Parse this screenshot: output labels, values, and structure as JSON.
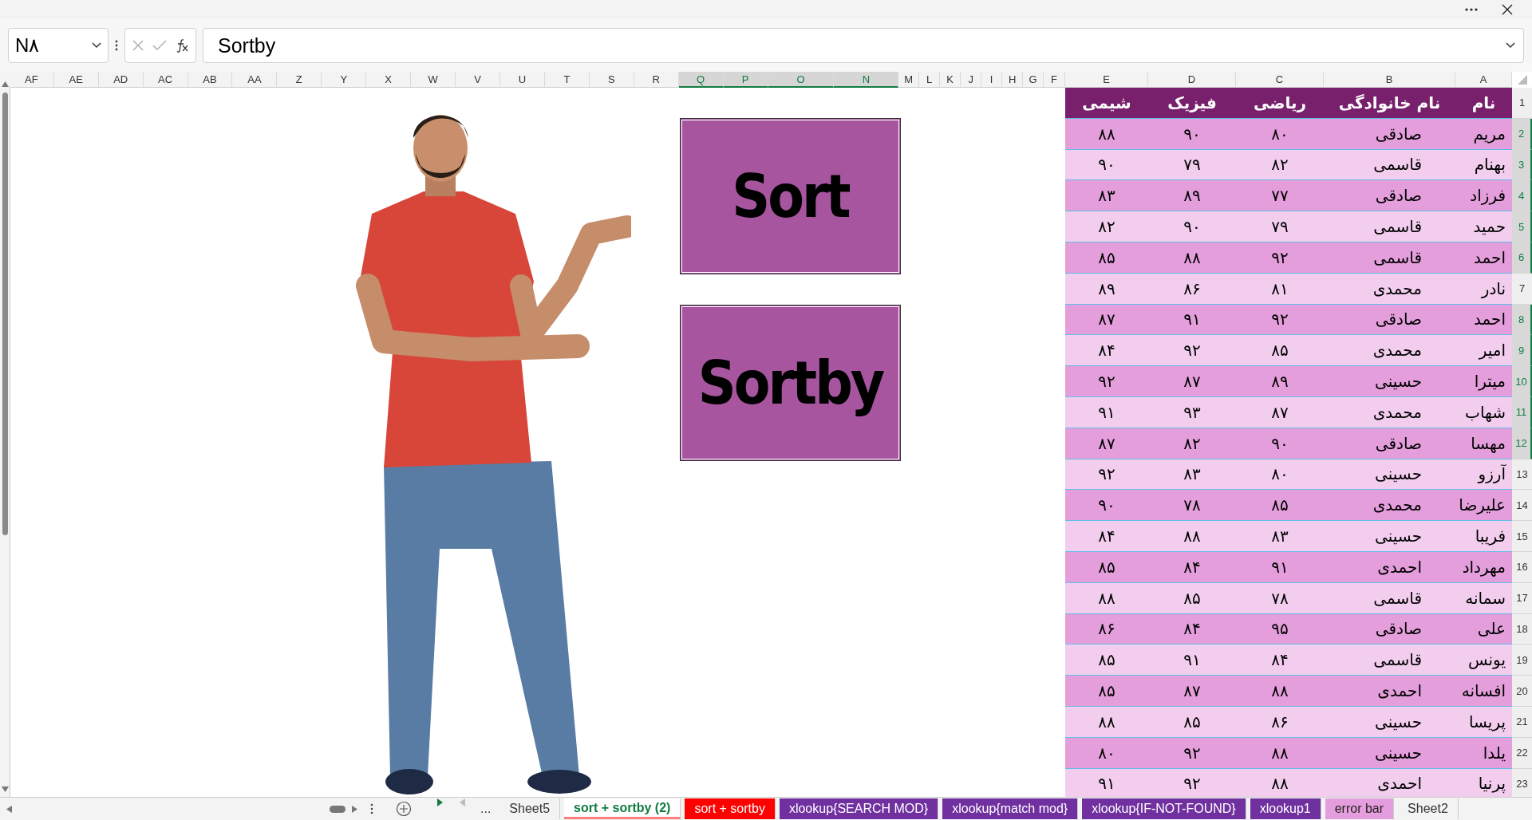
{
  "name_box": {
    "value": "N۸"
  },
  "formula_bar": {
    "value": "Sortby"
  },
  "columns_left": [
    {
      "label": "F",
      "selected": false
    },
    {
      "label": "G",
      "selected": false
    },
    {
      "label": "H",
      "selected": false
    },
    {
      "label": "I",
      "selected": false
    },
    {
      "label": "J",
      "selected": false
    },
    {
      "label": "K",
      "selected": false
    },
    {
      "label": "L",
      "selected": false
    },
    {
      "label": "M",
      "selected": false
    },
    {
      "label": "N",
      "selected": true
    },
    {
      "label": "O",
      "selected": true
    },
    {
      "label": "P",
      "selected": true
    },
    {
      "label": "Q",
      "selected": true
    },
    {
      "label": "R",
      "selected": false
    },
    {
      "label": "S",
      "selected": false
    },
    {
      "label": "T",
      "selected": false
    },
    {
      "label": "U",
      "selected": false
    },
    {
      "label": "V",
      "selected": false
    },
    {
      "label": "W",
      "selected": false
    },
    {
      "label": "X",
      "selected": false
    },
    {
      "label": "Y",
      "selected": false
    },
    {
      "label": "Z",
      "selected": false
    },
    {
      "label": "AA",
      "selected": false
    },
    {
      "label": "AB",
      "selected": false
    },
    {
      "label": "AC",
      "selected": false
    },
    {
      "label": "AD",
      "selected": false
    },
    {
      "label": "AE",
      "selected": false
    },
    {
      "label": "AF",
      "selected": false
    }
  ],
  "shapes": [
    {
      "label": "Sort"
    },
    {
      "label": "Sortby"
    }
  ],
  "table": {
    "columns": [
      {
        "letter": "A",
        "selected": false
      },
      {
        "letter": "B",
        "selected": false
      },
      {
        "letter": "C",
        "selected": false
      },
      {
        "letter": "D",
        "selected": false
      },
      {
        "letter": "E",
        "selected": false
      }
    ],
    "rows": [
      {
        "number": "1",
        "selected": false,
        "kind": "header",
        "cells": [
          "نام",
          "نام خانوادگی",
          "ریاضی",
          "فیزیک",
          "شیمی"
        ]
      },
      {
        "number": "2",
        "selected": true,
        "kind": "data",
        "cells": [
          "مریم",
          "صادقی",
          "۸۰",
          "۹۰",
          "۸۸"
        ]
      },
      {
        "number": "3",
        "selected": true,
        "kind": "data",
        "cells": [
          "بهنام",
          "قاسمی",
          "۸۲",
          "۷۹",
          "۹۰"
        ]
      },
      {
        "number": "4",
        "selected": true,
        "kind": "data",
        "cells": [
          "فرزاد",
          "صادقی",
          "۷۷",
          "۸۹",
          "۸۳"
        ]
      },
      {
        "number": "5",
        "selected": true,
        "kind": "data",
        "cells": [
          "حمید",
          "قاسمی",
          "۷۹",
          "۹۰",
          "۸۲"
        ]
      },
      {
        "number": "6",
        "selected": true,
        "kind": "data",
        "cells": [
          "احمد",
          "قاسمی",
          "۹۲",
          "۸۸",
          "۸۵"
        ]
      },
      {
        "number": "7",
        "selected": false,
        "kind": "data",
        "cells": [
          "نادر",
          "محمدی",
          "۸۱",
          "۸۶",
          "۸۹"
        ]
      },
      {
        "number": "8",
        "selected": true,
        "kind": "data",
        "cells": [
          "احمد",
          "صادقی",
          "۹۲",
          "۹۱",
          "۸۷"
        ]
      },
      {
        "number": "9",
        "selected": true,
        "kind": "data",
        "cells": [
          "امیر",
          "محمدی",
          "۸۵",
          "۹۲",
          "۸۴"
        ]
      },
      {
        "number": "10",
        "selected": true,
        "kind": "data",
        "cells": [
          "میترا",
          "حسینی",
          "۸۹",
          "۸۷",
          "۹۲"
        ]
      },
      {
        "number": "11",
        "selected": true,
        "kind": "data",
        "cells": [
          "شهاب",
          "محمدی",
          "۸۷",
          "۹۳",
          "۹۱"
        ]
      },
      {
        "number": "12",
        "selected": true,
        "kind": "data",
        "cells": [
          "مهسا",
          "صادقی",
          "۹۰",
          "۸۲",
          "۸۷"
        ]
      },
      {
        "number": "13",
        "selected": false,
        "kind": "data",
        "cells": [
          "آرزو",
          "حسینی",
          "۸۰",
          "۸۳",
          "۹۲"
        ]
      },
      {
        "number": "14",
        "selected": false,
        "kind": "data",
        "cells": [
          "علیرضا",
          "محمدی",
          "۸۵",
          "۷۸",
          "۹۰"
        ]
      },
      {
        "number": "15",
        "selected": false,
        "kind": "data",
        "cells": [
          "فریبا",
          "حسینی",
          "۸۳",
          "۸۸",
          "۸۴"
        ]
      },
      {
        "number": "16",
        "selected": false,
        "kind": "data",
        "cells": [
          "مهرداد",
          "احمدی",
          "۹۱",
          "۸۴",
          "۸۵"
        ]
      },
      {
        "number": "17",
        "selected": false,
        "kind": "data",
        "cells": [
          "سمانه",
          "قاسمی",
          "۷۸",
          "۸۵",
          "۸۸"
        ]
      },
      {
        "number": "18",
        "selected": false,
        "kind": "data",
        "cells": [
          "علی",
          "صادقی",
          "۹۵",
          "۸۴",
          "۸۶"
        ]
      },
      {
        "number": "19",
        "selected": false,
        "kind": "data",
        "cells": [
          "یونس",
          "قاسمی",
          "۸۴",
          "۹۱",
          "۸۵"
        ]
      },
      {
        "number": "20",
        "selected": false,
        "kind": "data",
        "cells": [
          "افسانه",
          "احمدی",
          "۸۸",
          "۸۷",
          "۸۵"
        ]
      },
      {
        "number": "21",
        "selected": false,
        "kind": "data",
        "cells": [
          "پریسا",
          "حسینی",
          "۸۶",
          "۸۵",
          "۸۸"
        ]
      },
      {
        "number": "22",
        "selected": false,
        "kind": "data",
        "cells": [
          "یلدا",
          "حسینی",
          "۸۸",
          "۹۲",
          "۸۰"
        ]
      },
      {
        "number": "23",
        "selected": false,
        "kind": "data",
        "cells": [
          "پرنیا",
          "احمدی",
          "۸۸",
          "۹۲",
          "۹۱"
        ]
      }
    ]
  },
  "sheet_tabs": [
    {
      "label": "Sheet2",
      "selected": false
    },
    {
      "label": "error bar",
      "selected": false,
      "color": "#e59edd"
    },
    {
      "label": "xlookup1",
      "selected": false,
      "color": "#7030a0"
    },
    {
      "label": "xlookup{IF-NOT-FOUND}",
      "selected": false,
      "color": "#7030a0"
    },
    {
      "label": "xlookup{match mod}",
      "selected": false,
      "color": "#7030a0"
    },
    {
      "label": "xlookup{SEARCH MOD}",
      "selected": false,
      "color": "#7030a0"
    },
    {
      "label": "sort + sortby",
      "selected": false,
      "color": "#ff0000"
    },
    {
      "label": "sort + sortby (2)",
      "selected": true,
      "color": "#ff7c80"
    },
    {
      "label": "Sheet5",
      "selected": false
    }
  ],
  "tab_overflow": "..."
}
